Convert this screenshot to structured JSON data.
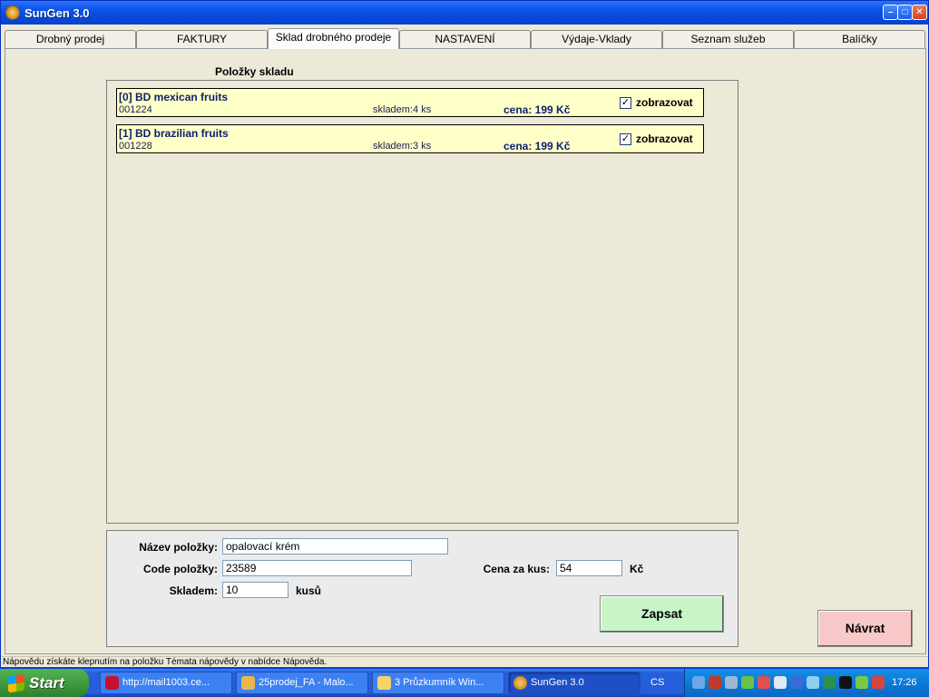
{
  "window": {
    "title": "SunGen 3.0",
    "min_glyph": "–",
    "max_glyph": "□",
    "close_glyph": "✕"
  },
  "tabs": [
    {
      "label": "Drobný prodej",
      "active": false
    },
    {
      "label": "FAKTURY",
      "active": false
    },
    {
      "label": "Sklad drobného prodeje",
      "active": true
    },
    {
      "label": "NASTAVENÍ",
      "active": false
    },
    {
      "label": "Výdaje-Vklady",
      "active": false
    },
    {
      "label": "Seznam služeb",
      "active": false
    },
    {
      "label": "Balíčky",
      "active": false
    }
  ],
  "stock": {
    "title": "Položky skladu",
    "items": [
      {
        "name": "[0] BD mexican fruits",
        "code": "001224",
        "stock": "skladem:4 ks",
        "price": "cena: 199 Kč",
        "show_label": "zobrazovat",
        "checked": true
      },
      {
        "name": "[1] BD brazilian fruits",
        "code": "001228",
        "stock": "skladem:3 ks",
        "price": "cena: 199 Kč",
        "show_label": "zobrazovat",
        "checked": true
      }
    ]
  },
  "form": {
    "name_label": "Název položky:",
    "name_value": "opalovací krém",
    "code_label": "Code položky:",
    "code_value": "23589",
    "stock_label": "Skladem:",
    "stock_value": "10",
    "stock_unit": "kusů",
    "price_label": "Cena za kus:",
    "price_value": "54",
    "price_unit": "Kč",
    "save_label": "Zapsat"
  },
  "back_label": "Návrat",
  "statusbar": {
    "text": "Nápovědu získáte klepnutím na položku Témata nápovědy v nabídce Nápověda."
  },
  "taskbar": {
    "start_label": "Start",
    "tasks": [
      {
        "label": "http://mail1003.ce...",
        "icon": "opera-icon",
        "active": false
      },
      {
        "label": "25prodej_FA - Malo...",
        "icon": "paint-icon",
        "active": false
      },
      {
        "label": "3 Průzkumník Win...",
        "icon": "folder-icon",
        "active": false
      },
      {
        "label": "SunGen 3.0",
        "icon": "sungen-icon",
        "active": true
      }
    ],
    "language": "CS",
    "clock": "17:26"
  }
}
